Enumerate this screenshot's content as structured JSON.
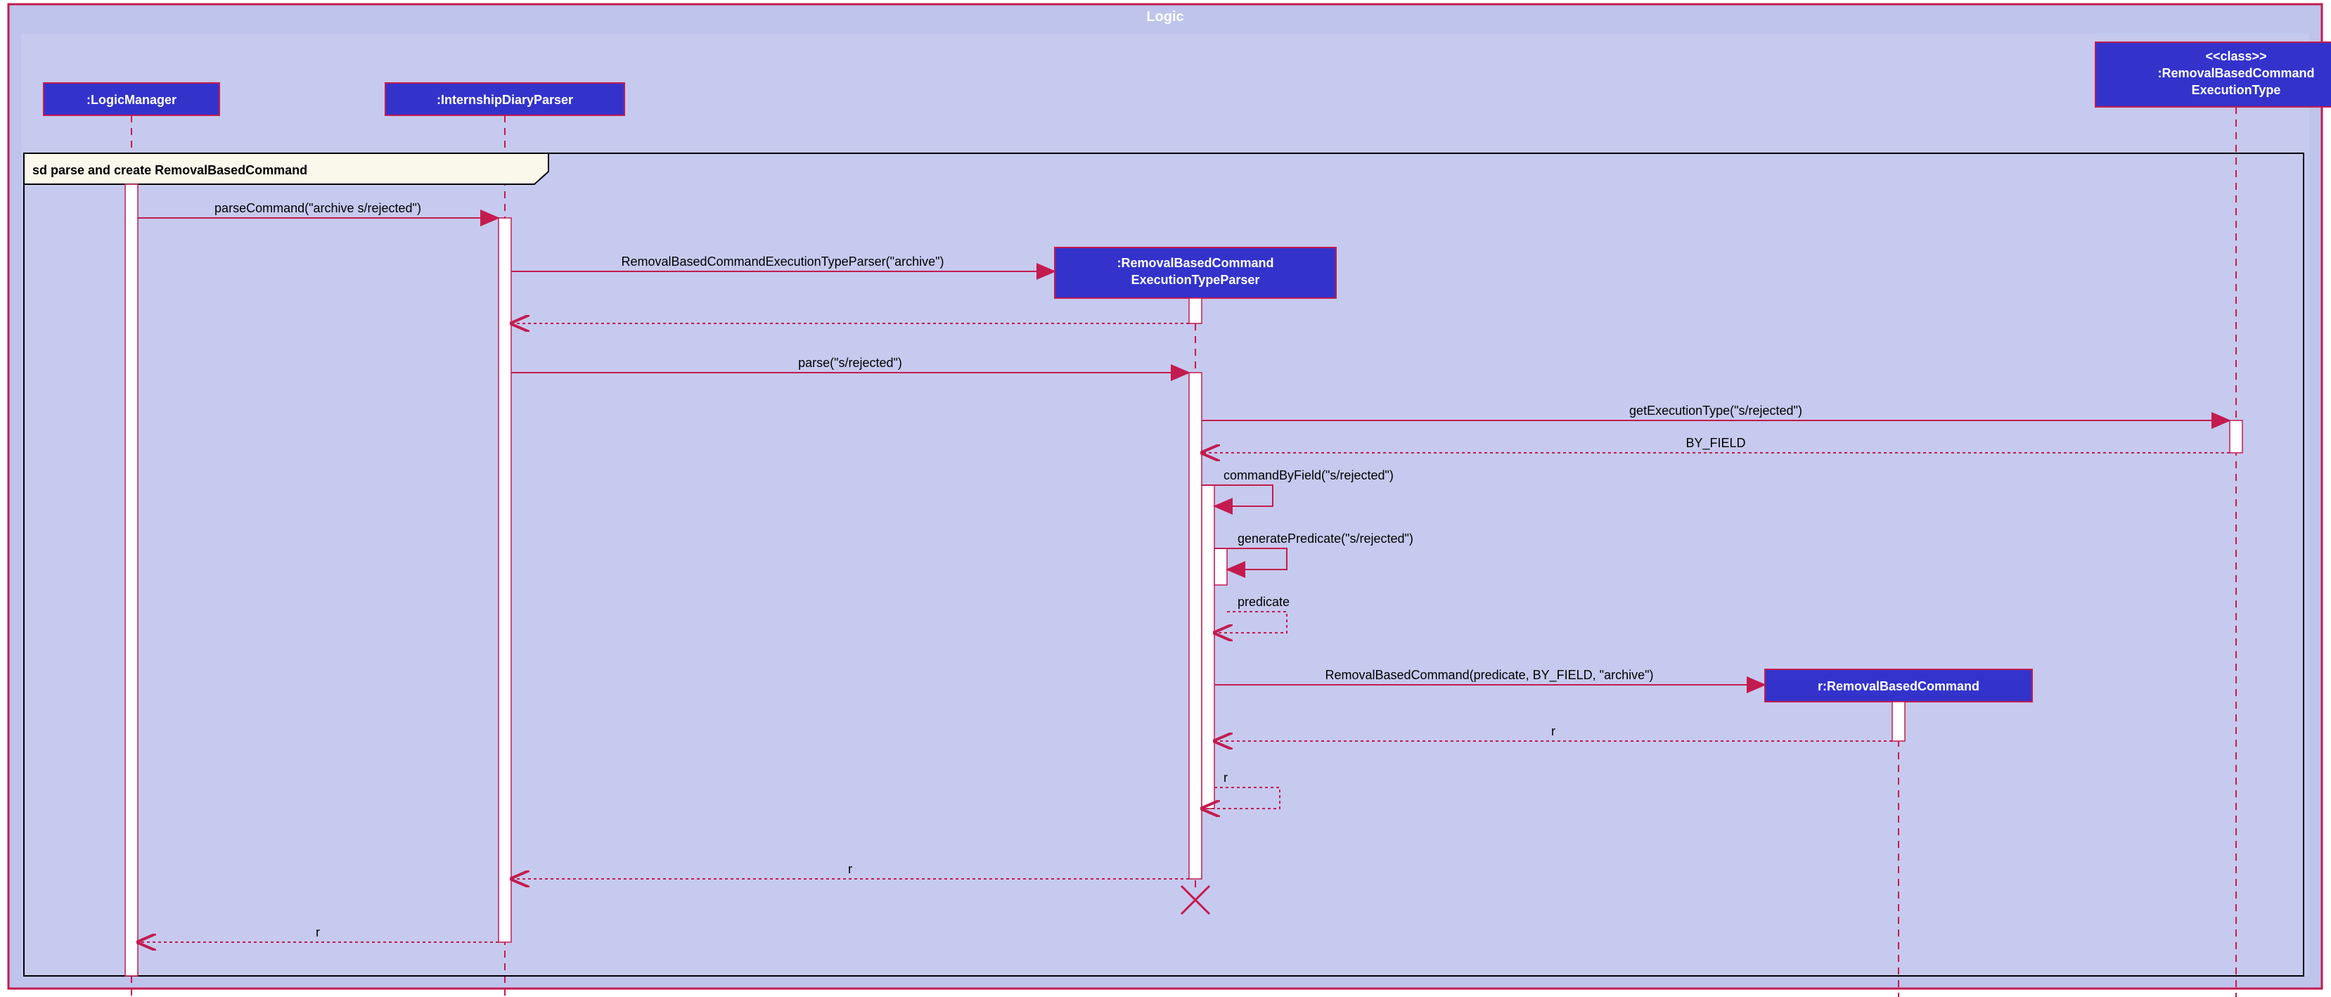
{
  "frame": {
    "title": "Logic"
  },
  "participants": {
    "logicManager": ":LogicManager",
    "diaryParser": ":InternshipDiaryParser",
    "execTypeParser1": ":RemovalBasedCommand",
    "execTypeParser2": "ExecutionTypeParser",
    "removalCmd": "r:RemovalBasedCommand",
    "execTypeStereo": "<<class>>",
    "execType1": ":RemovalBasedCommand",
    "execType2": "ExecutionType"
  },
  "sd": {
    "label": "sd parse and create RemovalBasedCommand"
  },
  "messages": {
    "m1": "parseCommand(\"archive s/rejected\")",
    "m2": "RemovalBasedCommandExecutionTypeParser(\"archive\")",
    "m3": "parse(\"s/rejected\")",
    "m4": "getExecutionType(\"s/rejected\")",
    "m5": "BY_FIELD",
    "m6": "commandByField(\"s/rejected\")",
    "m7": "generatePredicate(\"s/rejected\")",
    "m8": "predicate",
    "m9": "RemovalBasedCommand(predicate, BY_FIELD, \"archive\")",
    "m10": "r",
    "m11": "r",
    "m12": "r",
    "m13": "r"
  }
}
